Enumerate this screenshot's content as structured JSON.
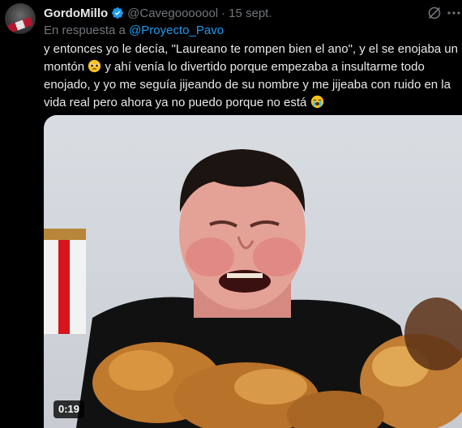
{
  "post": {
    "author_name": "GordoMillo",
    "handle": "@Cavegooooool",
    "separator": "·",
    "date": "15 sept.",
    "verified_icon": "verified-badge-icon",
    "reply_prefix": "En respuesta a",
    "reply_to": "@Proyecto_Pavo",
    "text_part1": "y entonces yo le decía, \"Laureano te rompen bien el ano\", y el se enojaba un montón",
    "text_part2": " y ahí venía lo divertido porque empezaba a insultarme todo enojado, y yo me seguía jijeando de su nombre y me jijeaba con ruido en la vida real pero ahora ya no puedo porque no está",
    "emoji1": "pleading-face-icon",
    "emoji2": "loudly-crying-face-icon"
  },
  "video": {
    "duration": "0:19",
    "thumbnail": "crying-man-with-fried-chicken"
  },
  "colors": {
    "background": "#000000",
    "text": "#e7e9ea",
    "muted": "#71767b",
    "link": "#1d9bf0",
    "verified": "#1d9bf0"
  }
}
